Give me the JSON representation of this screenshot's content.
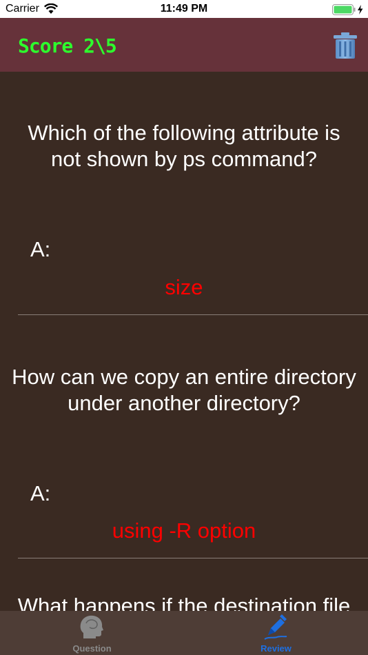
{
  "status_bar": {
    "carrier": "Carrier",
    "time": "11:49 PM"
  },
  "header": {
    "score": "Score 2\\5",
    "trash_icon": "trash-icon"
  },
  "review_items": [
    {
      "question": "Which of the following attribute is not shown by ps command?",
      "answer_prefix": "A:",
      "answer": "size"
    },
    {
      "question": "How can we copy an entire directory under another directory?",
      "answer_prefix": "A:",
      "answer": "using -R option"
    },
    {
      "question": "What happens if the destination file"
    }
  ],
  "tab_bar": {
    "tabs": [
      {
        "label": "Question",
        "icon": "head-icon",
        "selected": false
      },
      {
        "label": "Review",
        "icon": "pen-icon",
        "selected": true
      }
    ]
  },
  "colors": {
    "background": "#3a2a22",
    "header": "#66323a",
    "score": "#2dff2d",
    "answer": "#ff0000",
    "tab_selected": "#1e6fe0"
  }
}
